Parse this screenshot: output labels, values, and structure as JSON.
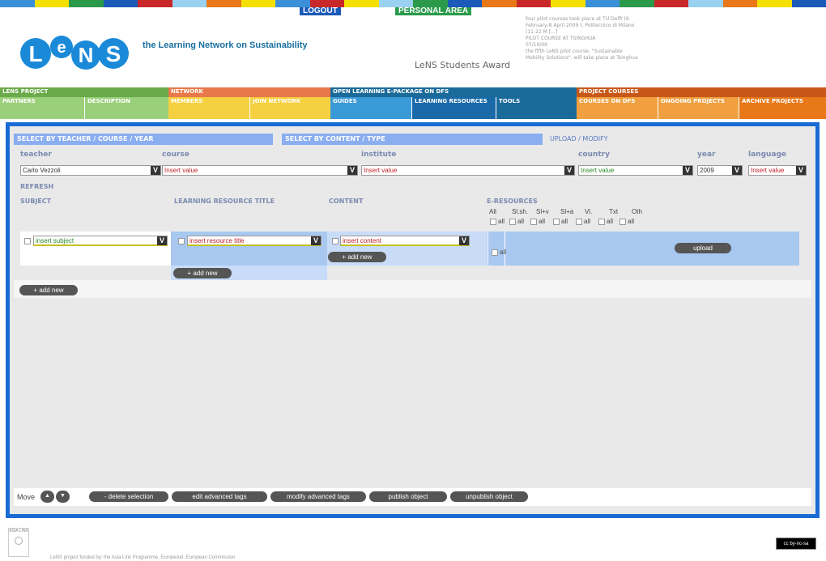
{
  "header": {
    "logout": "LOGOUT",
    "personal_area": "PERSONAL AREA",
    "logo": "LeNS",
    "tagline": "the Learning Network on Sustainability",
    "award": "LeNS Students Award",
    "news": [
      "four pilot courses took place at TU Delft (9",
      "February-8 April 2009 ), Politecnico di Milano",
      "(11-22 M [...]",
      "",
      "PILOT COURSE AT TSINGHUA",
      "07/10/09",
      "the fifth LeNS pilot course, \"Sustainable",
      "Mobility Solutions\", will take place at Tsinghua"
    ]
  },
  "nav": {
    "row1": [
      "LENS PROJECT",
      "NETWORK",
      "OPEN LEARNING E-PACKAGE ON DFS",
      "PROJECT COURSES"
    ],
    "row2": [
      "PARTNERS",
      "DESCRIPTION",
      "MEMBERS",
      "JOIN NETWORK",
      "GUIDES",
      "LEARNING RESOURCES",
      "TOOLS",
      "COURSES ON DFS",
      "ONGOING PROJECTS",
      "ARCHIVE PROJECTS"
    ]
  },
  "tabs": {
    "teacher": "SELECT BY TEACHER / COURSE / YEAR",
    "content": "SELECT BY CONTENT / TYPE",
    "upload": "UPLOAD / MODIFY"
  },
  "filters": {
    "teacher_label": "teacher",
    "course_label": "course",
    "institute_label": "institute",
    "country_label": "country",
    "year_label": "year",
    "language_label": "language",
    "teacher": "Carlo Vezzoli",
    "course": "Insert value",
    "institute": "Insert value",
    "country": "Insert value",
    "year": "2009",
    "language": "Insert value",
    "refresh": "REFRESH"
  },
  "columns": {
    "subject": "SUBJECT",
    "title": "LEARNING RESOURCE TITLE",
    "content": "CONTENT",
    "eres": "E-RESOURCES"
  },
  "eres": {
    "types": [
      "All",
      "Sl.sh.",
      "Sl+v",
      "Sl+a",
      "Vi.",
      "Txt",
      "Oth"
    ],
    "all": "all"
  },
  "row": {
    "subject": "insert subject",
    "title": "insert resource title",
    "content": "insert content",
    "all": "all",
    "upload": "upload",
    "add_new": "+ add new"
  },
  "toolbar": {
    "move": "Move",
    "delete": "- delete selection",
    "edit": "edit advanced tags",
    "modify": "modify advanced tags",
    "publish": "publish object",
    "unpublish": "unpublish object"
  },
  "footer": {
    "funding": "LeNS project funded by: the Asia Link Programme, EuropeAid, European Commission",
    "asia_link": "ASIA LINK",
    "cc": "cc by-nc-sa"
  },
  "v_glyph": "V"
}
